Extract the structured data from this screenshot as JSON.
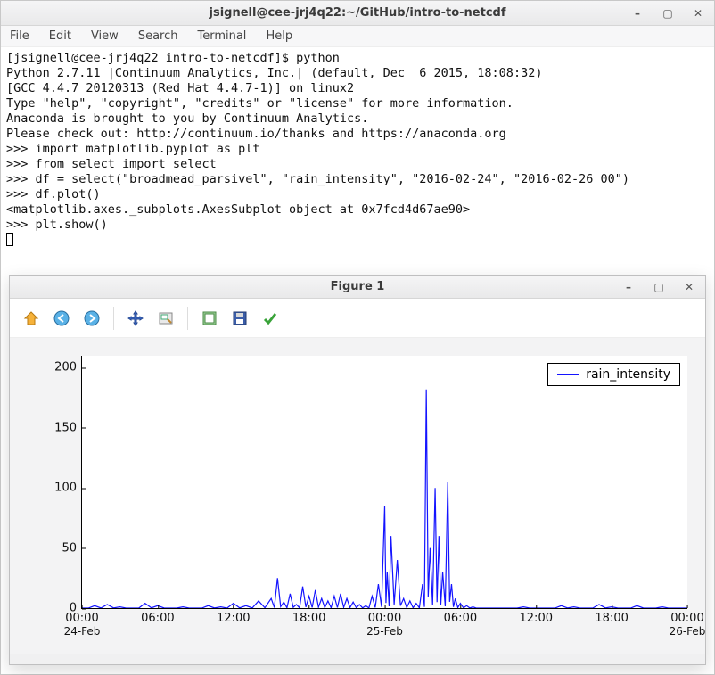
{
  "terminal": {
    "title": "jsignell@cee-jrj4q22:~/GitHub/intro-to-netcdf",
    "menubar": [
      "File",
      "Edit",
      "View",
      "Search",
      "Terminal",
      "Help"
    ],
    "lines": [
      "[jsignell@cee-jrj4q22 intro-to-netcdf]$ python",
      "Python 2.7.11 |Continuum Analytics, Inc.| (default, Dec  6 2015, 18:08:32)",
      "[GCC 4.4.7 20120313 (Red Hat 4.4.7-1)] on linux2",
      "Type \"help\", \"copyright\", \"credits\" or \"license\" for more information.",
      "Anaconda is brought to you by Continuum Analytics.",
      "Please check out: http://continuum.io/thanks and https://anaconda.org",
      ">>> import matplotlib.pyplot as plt",
      ">>> from select import select",
      ">>> df = select(\"broadmead_parsivel\", \"rain_intensity\", \"2016-02-24\", \"2016-02-26 00\")",
      ">>> df.plot()",
      "<matplotlib.axes._subplots.AxesSubplot object at 0x7fcd4d67ae90>",
      ">>> plt.show()"
    ]
  },
  "figure": {
    "title": "Figure 1",
    "toolbar": [
      "home-icon",
      "back-icon",
      "forward-icon",
      "pan-icon",
      "zoom-icon",
      "configure-icon",
      "save-icon",
      "check-icon"
    ],
    "legend_label": "rain_intensity"
  },
  "chart_data": {
    "type": "line",
    "title": "",
    "xlabel": "",
    "ylabel": "",
    "ylim": [
      0,
      210
    ],
    "series": [
      {
        "name": "rain_intensity",
        "x_hours": [
          0,
          1,
          2,
          3,
          4,
          5,
          6,
          7,
          8,
          9,
          10,
          11,
          12,
          13,
          14,
          15,
          15.5,
          16,
          16.5,
          17,
          17.5,
          18,
          18.5,
          19,
          19.5,
          20,
          20.5,
          21,
          21.5,
          22,
          22.5,
          23,
          23.5,
          24,
          24.2,
          24.5,
          25,
          25.5,
          26,
          26.5,
          27,
          27.3,
          27.6,
          28,
          28.3,
          28.6,
          29,
          29.3,
          29.6,
          30,
          30.5,
          31,
          31.5,
          32,
          33,
          34,
          35,
          36,
          37,
          38,
          39,
          40,
          41,
          42,
          43,
          44,
          45,
          46,
          47,
          48
        ],
        "values": [
          0,
          2,
          3,
          1,
          0,
          4,
          2,
          0,
          1,
          0,
          2,
          1,
          4,
          2,
          6,
          8,
          25,
          5,
          12,
          3,
          18,
          10,
          15,
          8,
          6,
          10,
          12,
          8,
          5,
          3,
          2,
          10,
          20,
          85,
          30,
          60,
          40,
          8,
          6,
          4,
          20,
          182,
          50,
          100,
          60,
          30,
          105,
          20,
          8,
          4,
          2,
          1,
          0,
          0,
          0,
          0,
          1,
          0,
          0,
          2,
          1,
          0,
          3,
          1,
          0,
          2,
          0,
          1,
          0,
          0
        ]
      }
    ],
    "yticks": [
      0,
      50,
      100,
      150,
      200
    ],
    "xticks": [
      {
        "hours": 0,
        "top": "00:00",
        "bottom": "24-Feb"
      },
      {
        "hours": 6,
        "top": "06:00",
        "bottom": ""
      },
      {
        "hours": 12,
        "top": "12:00",
        "bottom": ""
      },
      {
        "hours": 18,
        "top": "18:00",
        "bottom": ""
      },
      {
        "hours": 24,
        "top": "00:00",
        "bottom": "25-Feb"
      },
      {
        "hours": 30,
        "top": "06:00",
        "bottom": ""
      },
      {
        "hours": 36,
        "top": "12:00",
        "bottom": ""
      },
      {
        "hours": 42,
        "top": "18:00",
        "bottom": ""
      },
      {
        "hours": 48,
        "top": "00:00",
        "bottom": "26-Feb"
      }
    ],
    "x_range_hours": [
      0,
      48
    ]
  }
}
